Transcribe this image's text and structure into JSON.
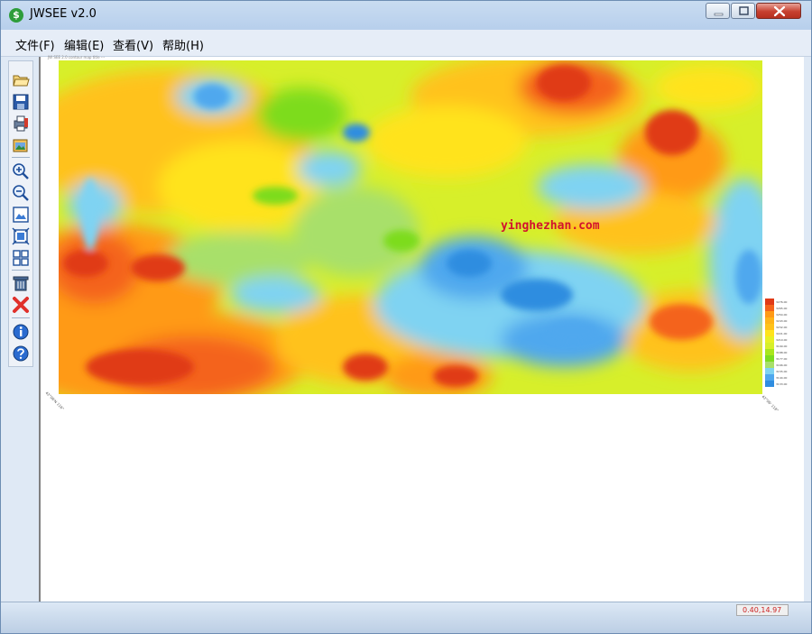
{
  "window": {
    "title": "JWSEE v2.0",
    "app_icon_glyph": "$"
  },
  "menu": {
    "items": [
      {
        "label": "文件(F)"
      },
      {
        "label": "编辑(E)"
      },
      {
        "label": "查看(V)"
      },
      {
        "label": "帮助(H)"
      }
    ]
  },
  "toolbar": {
    "tools": [
      {
        "name": "open-file-icon"
      },
      {
        "name": "save-icon"
      },
      {
        "name": "print-icon"
      },
      {
        "name": "export-image-icon"
      },
      {
        "name": "zoom-in-icon"
      },
      {
        "name": "zoom-out-icon"
      },
      {
        "name": "fit-to-window-icon"
      },
      {
        "name": "zoom-extent-icon"
      },
      {
        "name": "grid-view-icon"
      },
      {
        "name": "delete-icon"
      },
      {
        "name": "close-file-icon"
      },
      {
        "name": "info-icon"
      },
      {
        "name": "help-icon"
      }
    ]
  },
  "map": {
    "header_text": "JW SEE 2.0 contour map title ---",
    "corner_left": "42°06'N 116°",
    "corner_right": "42°06' 118°",
    "watermark": "yinghezhan.com",
    "colors": [
      "#2f8de0",
      "#4fa8ee",
      "#7fd3f2",
      "#a8e06a",
      "#7ddc1f",
      "#d7ef2a",
      "#ffe31c",
      "#ffc21a",
      "#ff9a16",
      "#f4631a",
      "#e03a16"
    ]
  },
  "legend": {
    "labels": [
      "3276.00",
      "3265.00",
      "3254.00",
      "3243.00",
      "3232.00",
      "3221.00",
      "3210.00",
      "3199.00",
      "3188.00",
      "3177.00",
      "3166.00",
      "3155.00",
      "3144.00",
      "3133.00"
    ]
  },
  "status": {
    "coords": "0.40,14.97"
  }
}
